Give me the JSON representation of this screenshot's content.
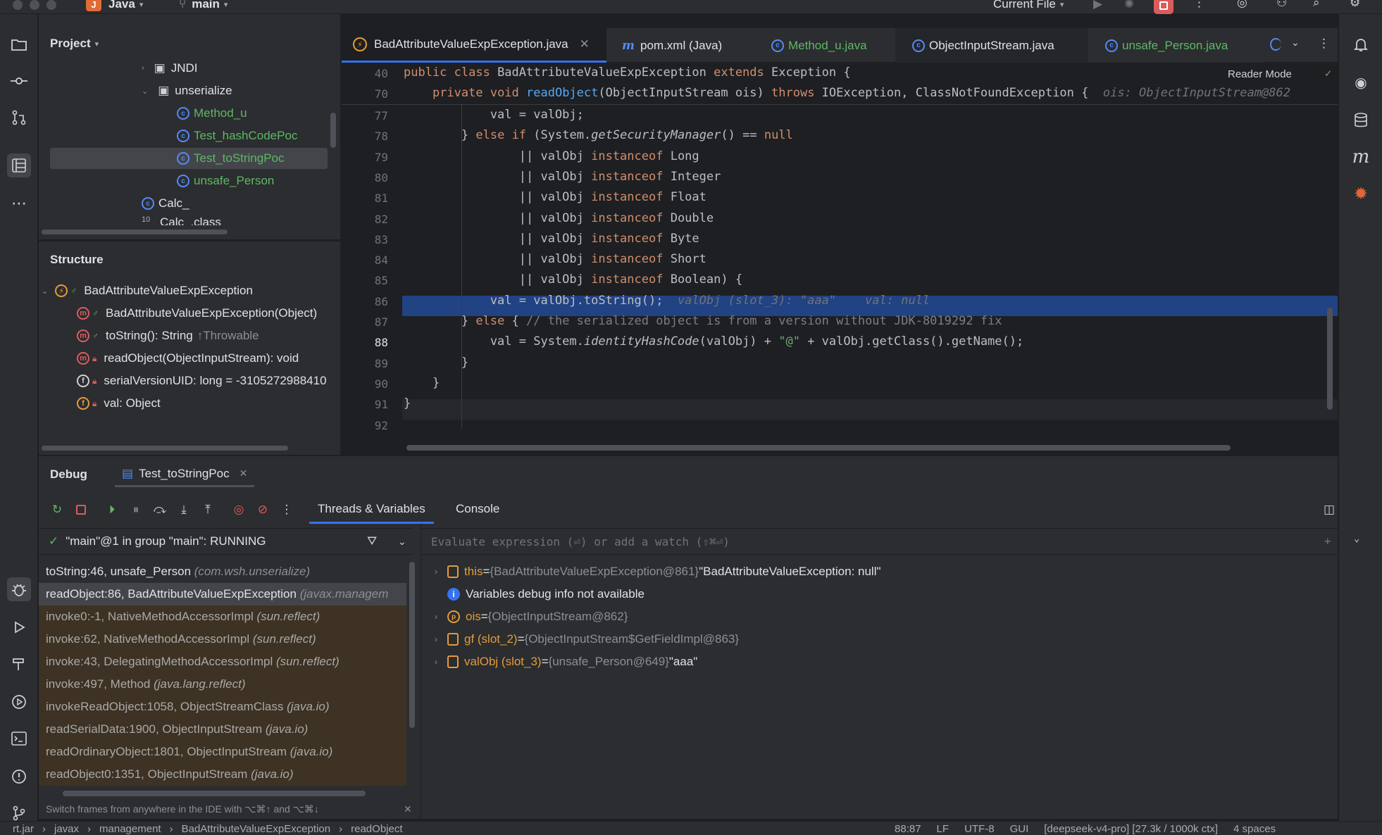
{
  "titlebar": {
    "project_badge": "J",
    "project_name": "Java",
    "branch": "main",
    "run_config": "Current File"
  },
  "project_panel": {
    "title": "Project",
    "items": [
      {
        "label": "JNDI",
        "kind": "folder"
      },
      {
        "label": "unserialize",
        "kind": "folder"
      },
      {
        "label": "Method_u",
        "kind": "class"
      },
      {
        "label": "Test_hashCodePoc",
        "kind": "class"
      },
      {
        "label": "Test_toStringPoc",
        "kind": "class"
      },
      {
        "label": "unsafe_Person",
        "kind": "class"
      },
      {
        "label": "Calc_",
        "kind": "class"
      },
      {
        "label": "Calc_.class",
        "kind": "file"
      }
    ]
  },
  "structure_panel": {
    "title": "Structure",
    "root": "BadAttributeValueExpException",
    "members": [
      {
        "label": "BadAttributeValueExpException(Object)",
        "suffix": ""
      },
      {
        "label": "toString(): String",
        "suffix": "↑Throwable"
      },
      {
        "label": "readObject(ObjectInputStream): void",
        "suffix": ""
      },
      {
        "label": "serialVersionUID: long = -3105272988410",
        "suffix": ""
      },
      {
        "label": "val: Object",
        "suffix": ""
      }
    ]
  },
  "editor": {
    "tabs": [
      {
        "label": "BadAttributeValueExpException.java",
        "active": true
      },
      {
        "label": "pom.xml (Java)",
        "active": false
      },
      {
        "label": "Method_u.java",
        "active": false
      },
      {
        "label": "ObjectInputStream.java",
        "active": false
      },
      {
        "label": "unsafe_Person.java",
        "active": false
      }
    ],
    "reader_mode": "Reader Mode",
    "sticky": [
      {
        "num": "40",
        "code": "public class BadAttributeValueExpException extends Exception {"
      },
      {
        "num": "70",
        "code": "    private void readObject(ObjectInputStream ois) throws IOException, ClassNotFoundException {",
        "hint": "ois: ObjectInputStream@862"
      }
    ],
    "lines": [
      {
        "num": "77",
        "code": "            val = valObj;"
      },
      {
        "num": "78",
        "code": "        } else if (System.getSecurityManager() == null"
      },
      {
        "num": "79",
        "code": "                || valObj instanceof Long"
      },
      {
        "num": "80",
        "code": "                || valObj instanceof Integer"
      },
      {
        "num": "81",
        "code": "                || valObj instanceof Float"
      },
      {
        "num": "82",
        "code": "                || valObj instanceof Double"
      },
      {
        "num": "83",
        "code": "                || valObj instanceof Byte"
      },
      {
        "num": "84",
        "code": "                || valObj instanceof Short"
      },
      {
        "num": "85",
        "code": "                || valObj instanceof Boolean) {"
      },
      {
        "num": "86",
        "code": "            val = valObj.toString();",
        "hint": "valObj (slot_3): \"aaa\"    val: null"
      },
      {
        "num": "87",
        "code": "        } else { // the serialized object is from a version without JDK-8019292 fix"
      },
      {
        "num": "88",
        "code": "            val = System.identityHashCode(valObj) + \"@\" + valObj.getClass().getName();"
      },
      {
        "num": "89",
        "code": "        }"
      },
      {
        "num": "90",
        "code": "    }"
      },
      {
        "num": "91",
        "code": "}"
      },
      {
        "num": "92",
        "code": ""
      }
    ],
    "highlighted_line": "86"
  },
  "debug": {
    "title": "Debug",
    "session_tab": "Test_toStringPoc",
    "tabs": [
      "Threads & Variables",
      "Console"
    ],
    "thread": "\"main\"@1 in group \"main\": RUNNING",
    "frames": [
      {
        "method": "toString:46, unsafe_Person",
        "pkg": "(com.wsh.unserialize)",
        "lib": false
      },
      {
        "method": "readObject:86, BadAttributeValueExpException",
        "pkg": "(javax.managem",
        "lib": false,
        "current": true
      },
      {
        "method": "invoke0:-1, NativeMethodAccessorImpl",
        "pkg": "(sun.reflect)",
        "lib": true
      },
      {
        "method": "invoke:62, NativeMethodAccessorImpl",
        "pkg": "(sun.reflect)",
        "lib": true
      },
      {
        "method": "invoke:43, DelegatingMethodAccessorImpl",
        "pkg": "(sun.reflect)",
        "lib": true
      },
      {
        "method": "invoke:497, Method",
        "pkg": "(java.lang.reflect)",
        "lib": true
      },
      {
        "method": "invokeReadObject:1058, ObjectStreamClass",
        "pkg": "(java.io)",
        "lib": true
      },
      {
        "method": "readSerialData:1900, ObjectInputStream",
        "pkg": "(java.io)",
        "lib": true
      },
      {
        "method": "readOrdinaryObject:1801, ObjectInputStream",
        "pkg": "(java.io)",
        "lib": true
      },
      {
        "method": "readObject0:1351, ObjectInputStream",
        "pkg": "(java.io)",
        "lib": true
      }
    ],
    "frames_hint": "Switch frames from anywhere in the IDE with ⌥⌘↑ and ⌥⌘↓",
    "evaluate_placeholder": "Evaluate expression (⏎) or add a watch (⇧⌘⏎)",
    "variables": [
      {
        "name": "this",
        "ref": "{BadAttributeValueExpException@861}",
        "value": "\"BadAttributeValueException: null\"",
        "expandable": true
      },
      {
        "name": "",
        "ref": "",
        "value": "Variables debug info not available",
        "expandable": false,
        "info": true
      },
      {
        "name": "ois",
        "ref": "{ObjectInputStream@862}",
        "value": "",
        "expandable": true
      },
      {
        "name": "gf (slot_2)",
        "ref": "{ObjectInputStream$GetFieldImpl@863}",
        "value": "",
        "expandable": true
      },
      {
        "name": "valObj (slot_3)",
        "ref": "{unsafe_Person@649}",
        "value": "\"aaa\"",
        "expandable": true
      }
    ]
  },
  "statusbar": {
    "breadcrumb": [
      "rt.jar",
      "javax",
      "management",
      "BadAttributeValueExpException",
      "readObject"
    ],
    "position": "88:87",
    "line_sep": "LF",
    "encoding": "UTF-8",
    "extra": "GUI",
    "ai": "[deepseek-v4-pro] [27.3k / 1000k ctx]",
    "indent": "4 spaces"
  },
  "colors": {
    "accent": "#3574f0",
    "keyword": "#cf8e6d",
    "method": "#56a8f5",
    "string": "#6aab73",
    "lib_frame": "#3d3223"
  }
}
